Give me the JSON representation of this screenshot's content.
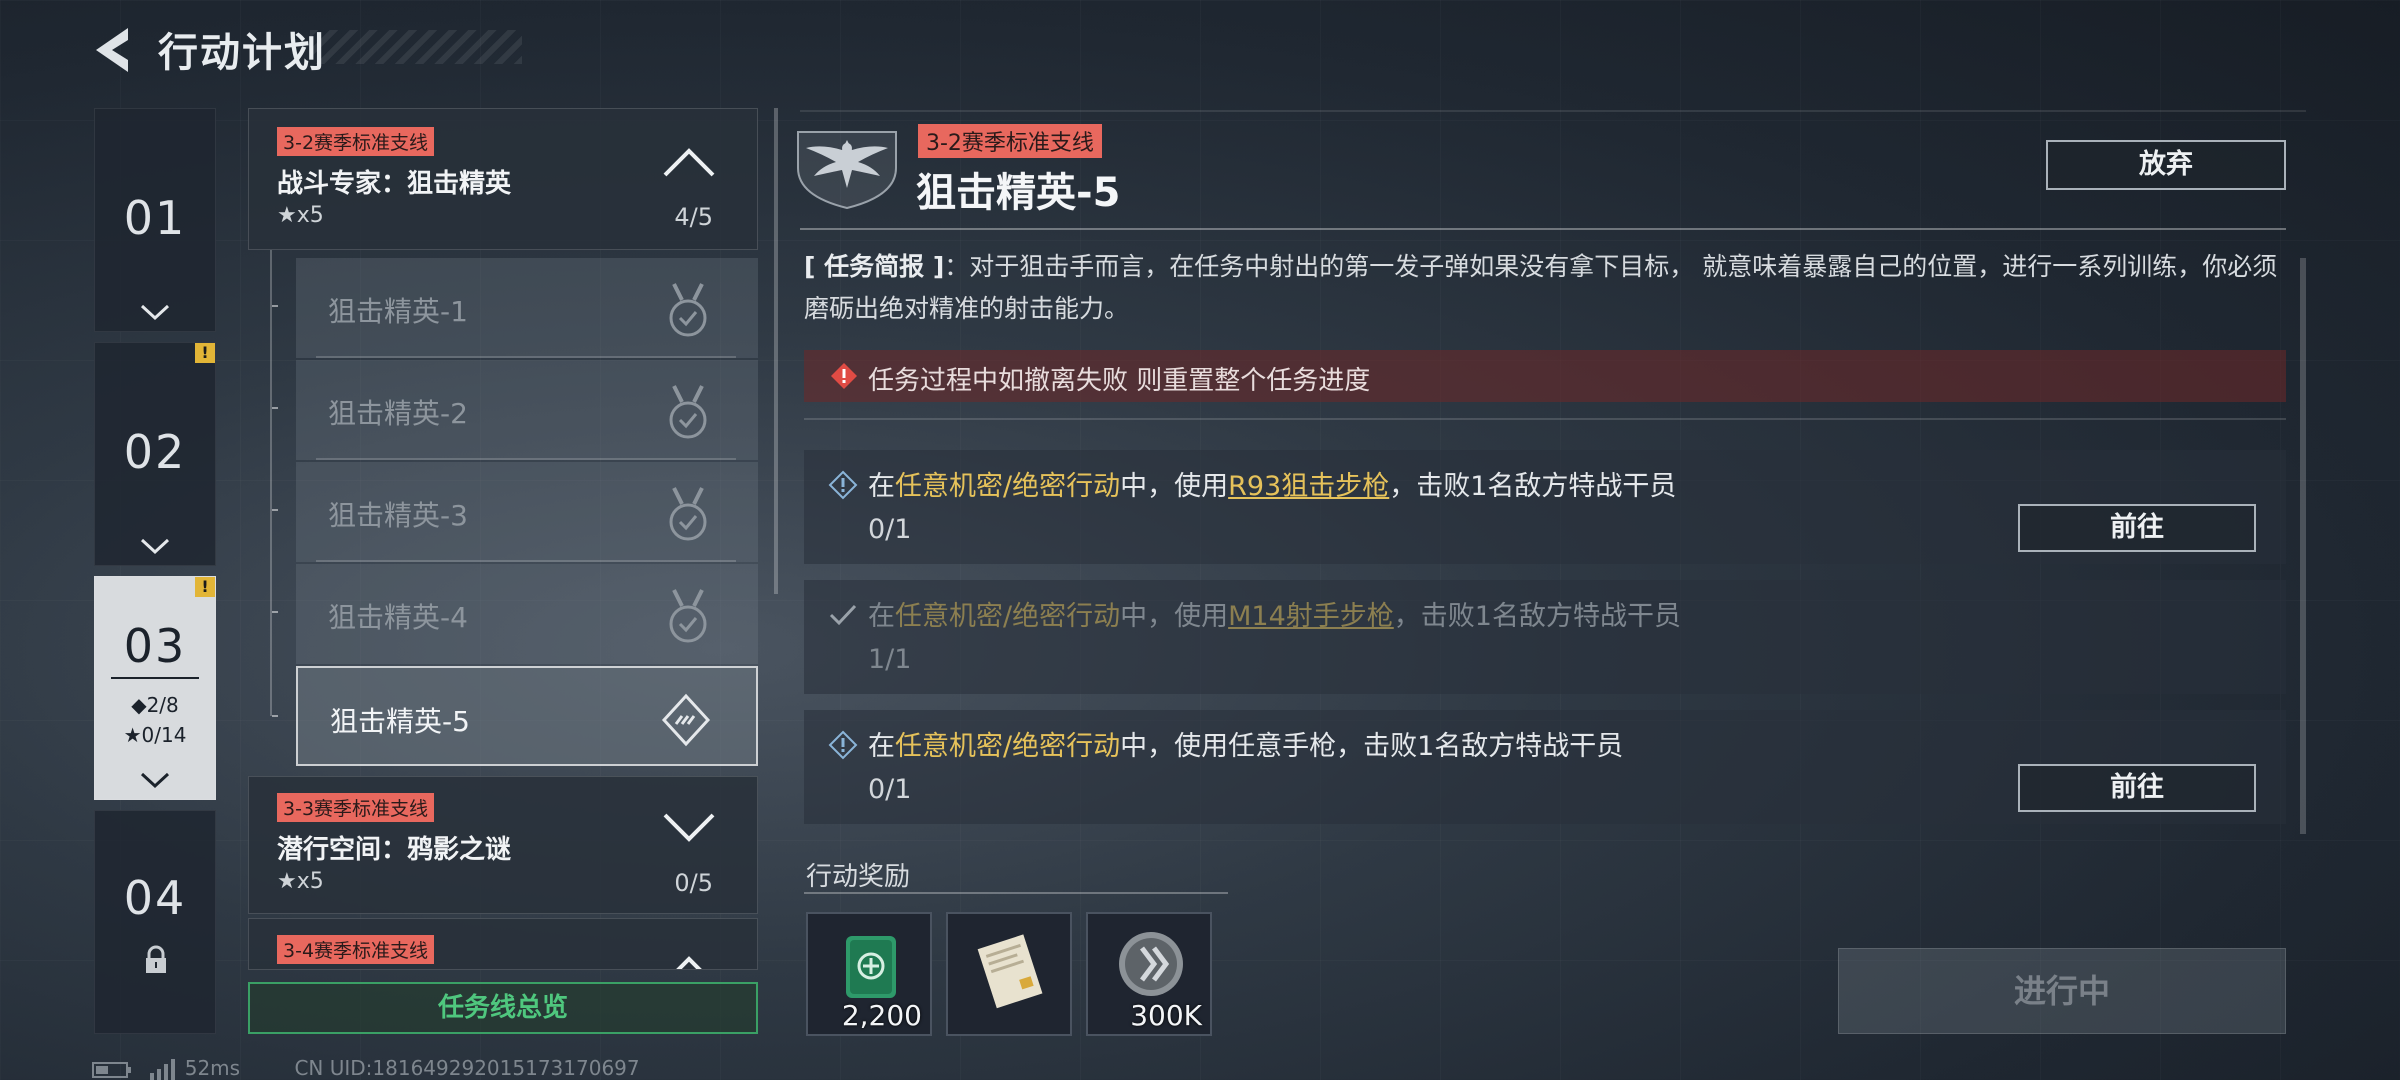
{
  "header": {
    "title": "行动计划"
  },
  "chapters": [
    {
      "num": "01"
    },
    {
      "num": "02",
      "badge": "!"
    },
    {
      "num": "03",
      "badge": "!",
      "diamonds": "◆2/8",
      "stars": "★0/14",
      "active": true
    },
    {
      "num": "04",
      "locked": true
    }
  ],
  "quests": [
    {
      "tag": "3-2赛季标准支线",
      "name": "战斗专家：狙击精英",
      "stars": "★x5",
      "progress": "4/5",
      "expanded": true
    },
    {
      "tag": "3-3赛季标准支线",
      "name": "潜行空间：鸦影之谜",
      "stars": "★x5",
      "progress": "0/5",
      "expanded": false
    },
    {
      "tag": "3-4赛季标准支线"
    }
  ],
  "sub_items": [
    {
      "label": "狙击精英-1",
      "state": "completed"
    },
    {
      "label": "狙击精英-2",
      "state": "completed"
    },
    {
      "label": "狙击精英-3",
      "state": "completed"
    },
    {
      "label": "狙击精英-4",
      "state": "completed"
    },
    {
      "label": "狙击精英-5",
      "state": "in-progress"
    }
  ],
  "overview_button": "任务线总览",
  "detail": {
    "tag": "3-2赛季标准支线",
    "title": "狙击精英-5",
    "abandon_label": "放弃",
    "brief_head": "[ 任务简报 ]",
    "brief_text": "：对于狙击手而言，在任务中射出的第一发子弹如果没有拿下目标， 就意味着暴露自己的位置，进行一系列训练，你必须磨砺出绝对精准的射击能力。",
    "warning": "任务过程中如撤离失败 则重置整个任务进度",
    "objectives": [
      {
        "pre": "在",
        "highlight": "任意机密/绝密行动",
        "mid": "中，使用",
        "weapon": "R93狙击步枪",
        "post": "，击败1名敌方特战干员",
        "progress": "0/1",
        "button": "前往",
        "done": false
      },
      {
        "pre": "在",
        "highlight": "任意机密/绝密行动",
        "mid": "中，使用",
        "weapon": "M14射手步枪",
        "post": "，击败1名敌方特战干员",
        "progress": "1/1",
        "done": true
      },
      {
        "pre": "在",
        "highlight": "任意机密/绝密行动",
        "mid": "中，使用任意手枪，击败1名敌方特战干员",
        "weapon": "",
        "post": "",
        "progress": "0/1",
        "button": "前往",
        "done": false
      }
    ],
    "rewards_title": "行动奖励",
    "rewards": [
      {
        "icon": "medkit-card-icon",
        "qty": "2,200"
      },
      {
        "icon": "document-icon",
        "qty": ""
      },
      {
        "icon": "coin-icon",
        "qty": "300K"
      }
    ],
    "status_label": "进行中"
  },
  "footer": {
    "ping": "52ms",
    "uid": "CN UID:1816492920151731706​97"
  },
  "colors": {
    "tag_red": "#e8685e",
    "highlight_gold": "#e6c25a",
    "overview_green": "#4fc77e",
    "warn_badge": "#e2b537"
  }
}
